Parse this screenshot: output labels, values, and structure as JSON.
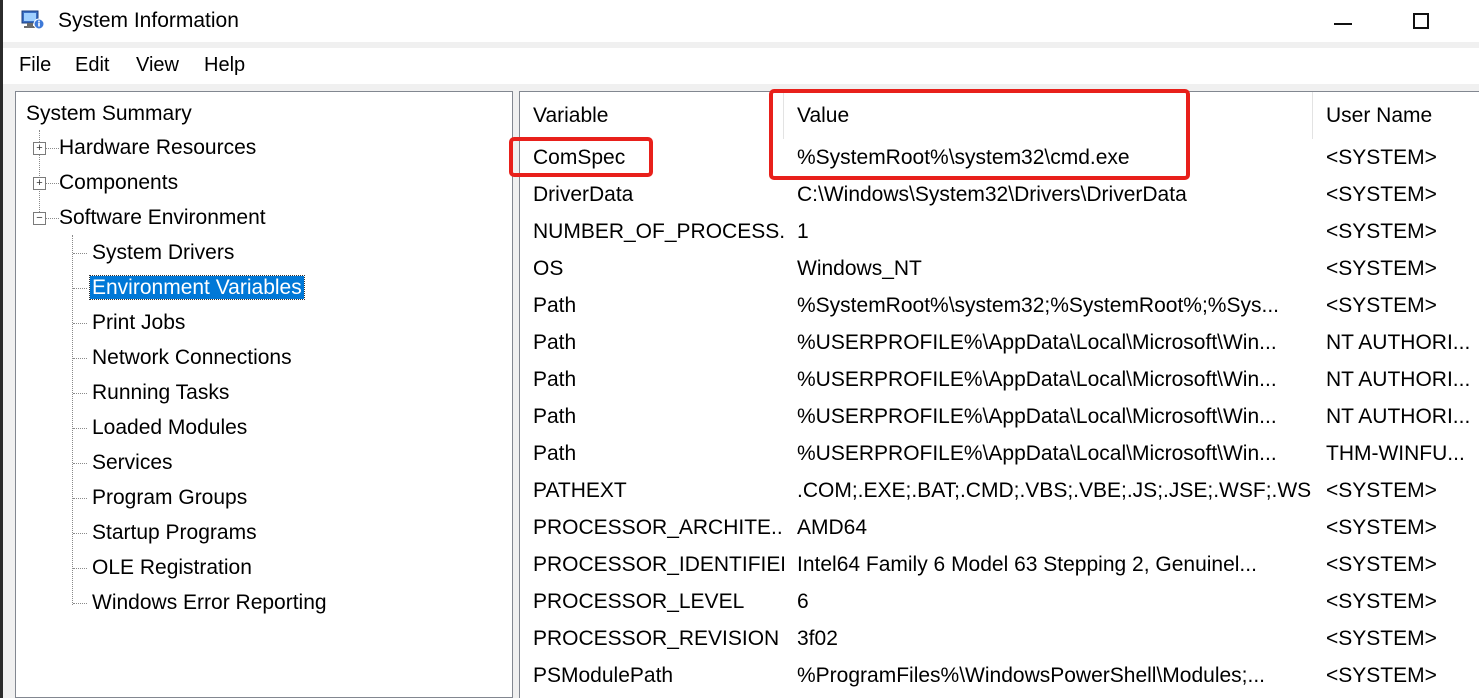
{
  "window": {
    "title": "System Information",
    "app_icon": "system-information-icon",
    "controls": [
      "minimize-icon",
      "maximize-icon"
    ]
  },
  "menu": [
    "File",
    "Edit",
    "View",
    "Help"
  ],
  "tree": {
    "root": "System Summary",
    "categories": [
      {
        "label": "Hardware Resources",
        "state": "collapsed"
      },
      {
        "label": "Components",
        "state": "collapsed"
      },
      {
        "label": "Software Environment",
        "state": "expanded"
      }
    ],
    "software_children": [
      "System Drivers",
      "Environment Variables",
      "Print Jobs",
      "Network Connections",
      "Running Tasks",
      "Loaded Modules",
      "Services",
      "Program Groups",
      "Startup Programs",
      "OLE Registration",
      "Windows Error Reporting"
    ],
    "selected": "Environment Variables"
  },
  "table": {
    "columns": [
      "Variable",
      "Value",
      "User Name"
    ],
    "rows": [
      [
        "ComSpec",
        "%SystemRoot%\\system32\\cmd.exe",
        "<SYSTEM>"
      ],
      [
        "DriverData",
        "C:\\Windows\\System32\\Drivers\\DriverData",
        "<SYSTEM>"
      ],
      [
        "NUMBER_OF_PROCESS...",
        "1",
        "<SYSTEM>"
      ],
      [
        "OS",
        "Windows_NT",
        "<SYSTEM>"
      ],
      [
        "Path",
        "%SystemRoot%\\system32;%SystemRoot%;%Sys...",
        "<SYSTEM>"
      ],
      [
        "Path",
        "%USERPROFILE%\\AppData\\Local\\Microsoft\\Win...",
        "NT AUTHORI..."
      ],
      [
        "Path",
        "%USERPROFILE%\\AppData\\Local\\Microsoft\\Win...",
        "NT AUTHORI..."
      ],
      [
        "Path",
        "%USERPROFILE%\\AppData\\Local\\Microsoft\\Win...",
        "NT AUTHORI..."
      ],
      [
        "Path",
        "%USERPROFILE%\\AppData\\Local\\Microsoft\\Win...",
        "THM-WINFU..."
      ],
      [
        "PATHEXT",
        ".COM;.EXE;.BAT;.CMD;.VBS;.VBE;.JS;.JSE;.WSF;.WS...",
        "<SYSTEM>"
      ],
      [
        "PROCESSOR_ARCHITE...",
        "AMD64",
        "<SYSTEM>"
      ],
      [
        "PROCESSOR_IDENTIFIER",
        "Intel64 Family 6 Model 63 Stepping 2, Genuinel...",
        "<SYSTEM>"
      ],
      [
        "PROCESSOR_LEVEL",
        "6",
        "<SYSTEM>"
      ],
      [
        "PROCESSOR_REVISION",
        "3f02",
        "<SYSTEM>"
      ],
      [
        "PSModulePath",
        "%ProgramFiles%\\WindowsPowerShell\\Modules;...",
        "<SYSTEM>"
      ]
    ]
  },
  "annotations": {
    "highlight_color": "#e8201b",
    "highlighted": [
      "Value",
      "ComSpec",
      "%SystemRoot%\\system32\\cmd.exe"
    ]
  },
  "colors": {
    "selection": "#0078d7"
  }
}
